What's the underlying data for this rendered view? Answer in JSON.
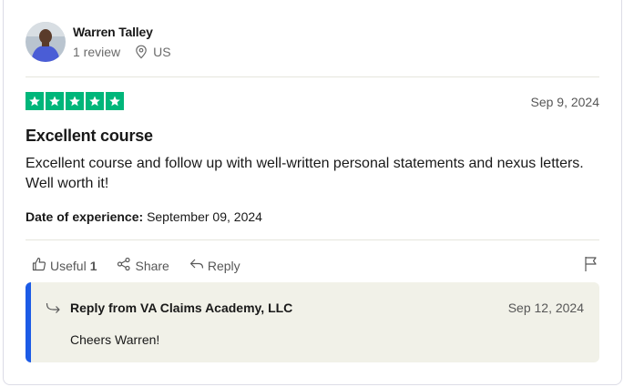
{
  "reviewer": {
    "name": "Warren Talley",
    "review_count": "1 review",
    "country": "US"
  },
  "review": {
    "rating": 5,
    "date": "Sep 9, 2024",
    "title": "Excellent course",
    "body": "Excellent course and follow up with well-written personal statements and nexus letters. Well worth it!",
    "experience_label": "Date of experience:",
    "experience_date": "September 09, 2024"
  },
  "actions": {
    "useful_label": "Useful",
    "useful_count": "1",
    "share_label": "Share",
    "reply_label": "Reply"
  },
  "company_reply": {
    "title": "Reply from VA Claims Academy, LLC",
    "date": "Sep 12, 2024",
    "text": "Cheers Warren!"
  },
  "colors": {
    "star_green": "#00b67a",
    "reply_accent": "#1c5be6",
    "reply_bg": "#f1f1e8"
  },
  "icons": [
    "location-pin-icon",
    "star-icon",
    "thumbs-up-icon",
    "share-icon",
    "reply-arrow-icon",
    "flag-icon",
    "company-reply-icon"
  ]
}
